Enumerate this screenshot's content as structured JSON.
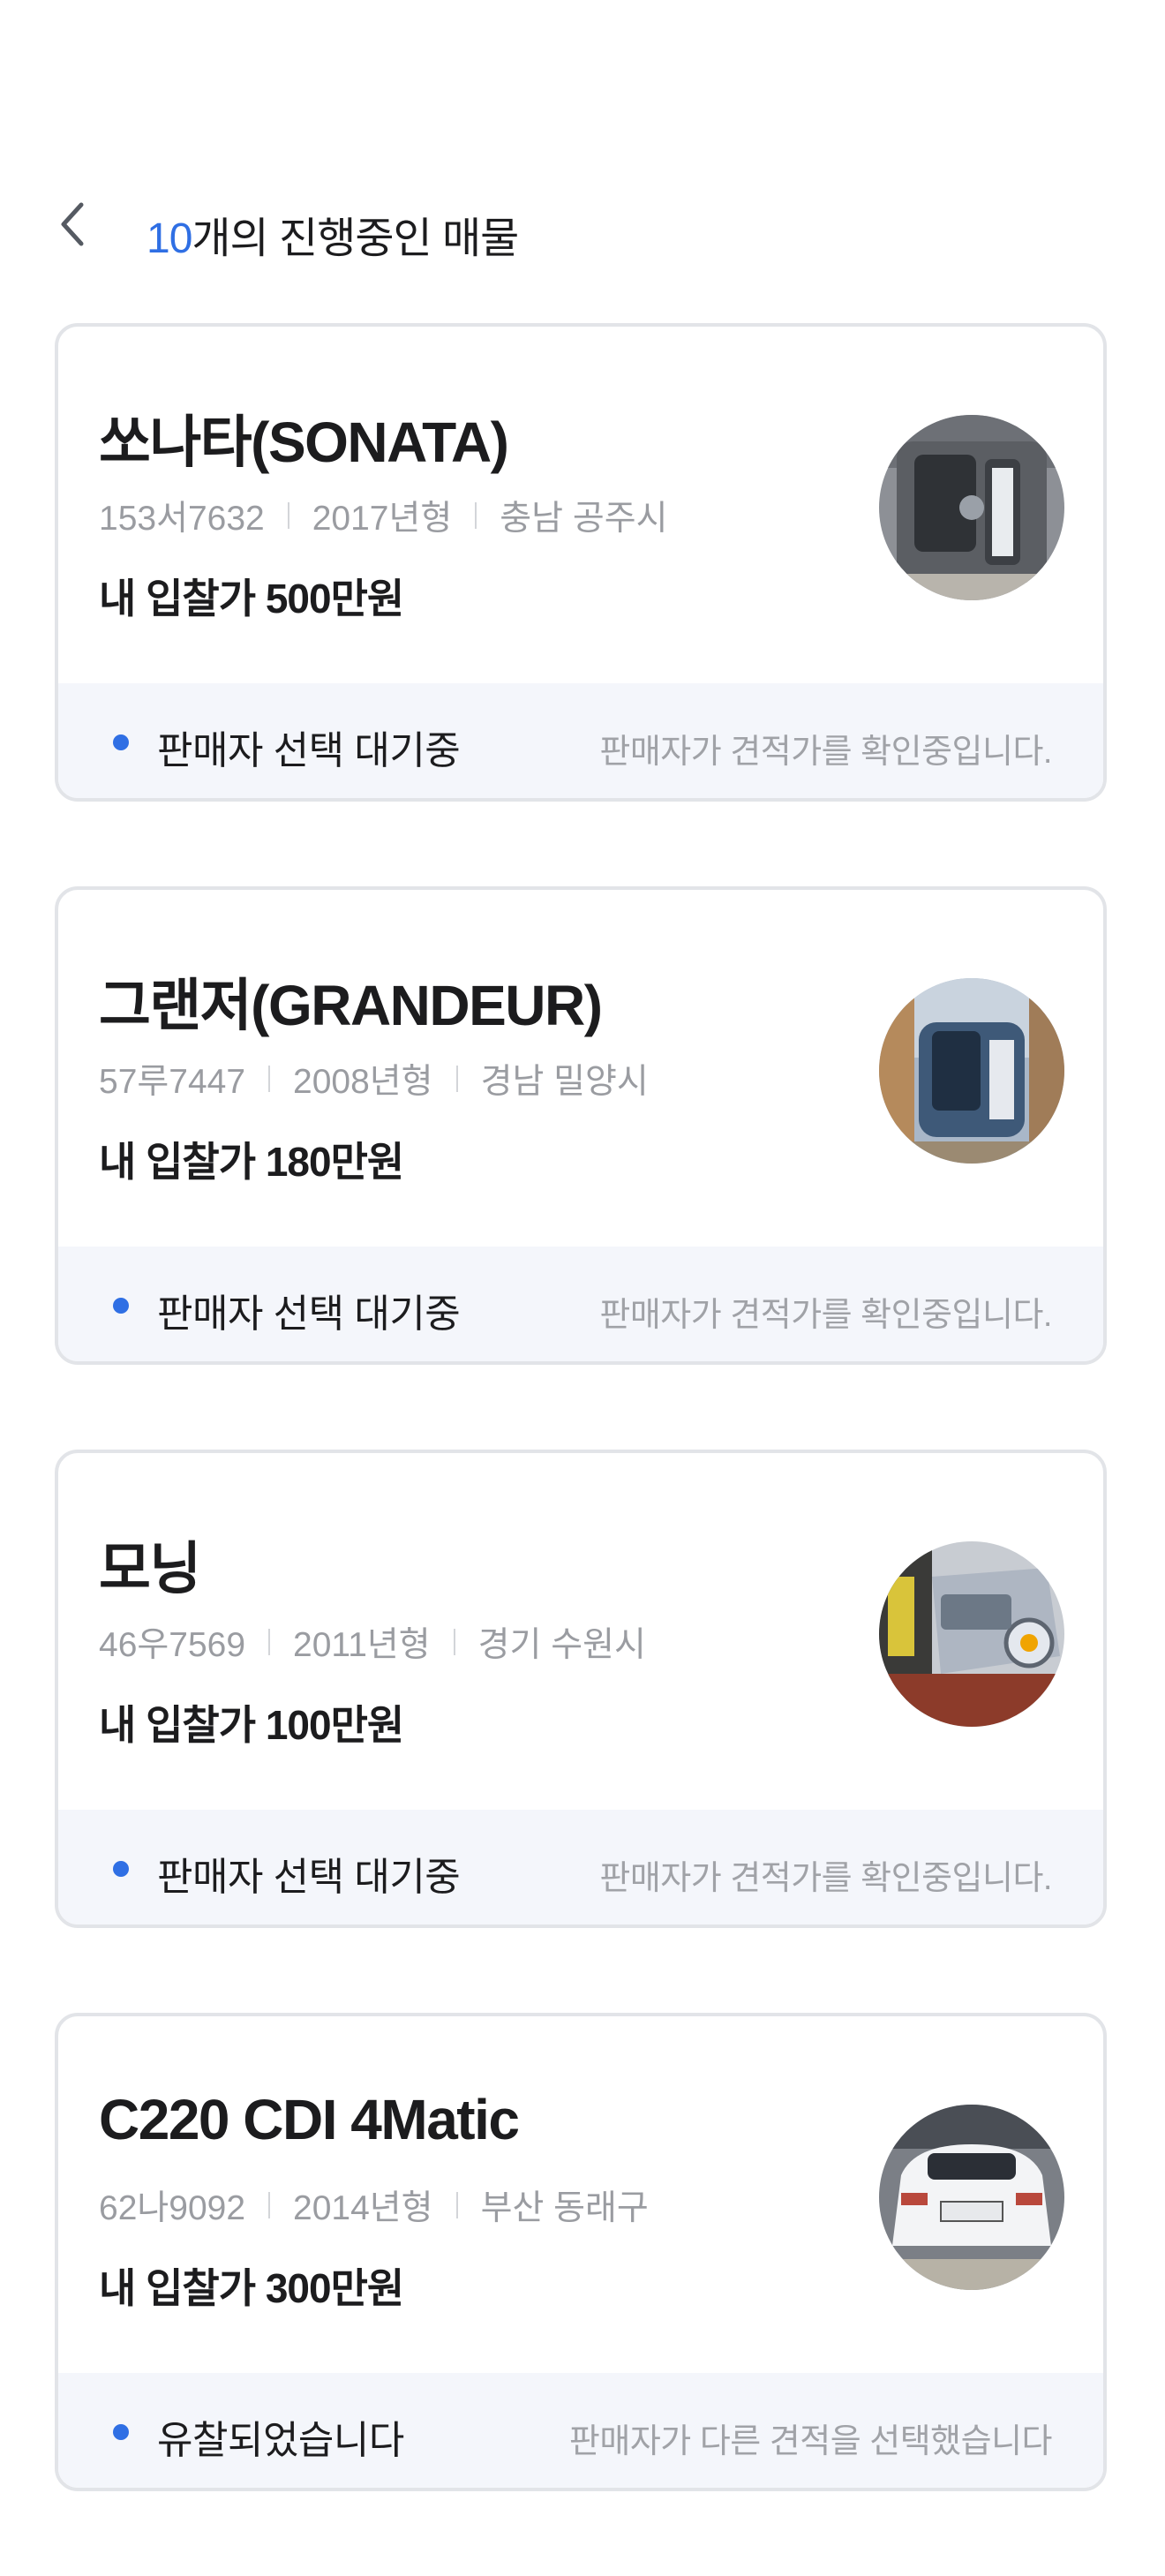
{
  "header": {
    "back_icon": "chevron-left-icon",
    "count": "10",
    "title_suffix": "개의 진행중인 매물"
  },
  "colors": {
    "accent": "#2f6fe4",
    "card_border": "#e2e4e8",
    "status_bg": "#f4f6fb",
    "muted_text": "#9a9ca1"
  },
  "listings": [
    {
      "name": "쏘나타(SONATA)",
      "plate": "153서7632",
      "year": "2017년형",
      "location": "충남 공주시",
      "bid": "내 입찰가 500만원",
      "status": "판매자 선택 대기중",
      "status_desc": "판매자가 견적가를 확인중입니다.",
      "photo": "gray-sedan-front"
    },
    {
      "name": "그랜저(GRANDEUR)",
      "plate": "57루7447",
      "year": "2008년형",
      "location": "경남 밀양시",
      "bid": "내 입찰가 180만원",
      "status": "판매자 선택 대기중",
      "status_desc": "판매자가 견적가를 확인중입니다.",
      "photo": "blue-sedan-front"
    },
    {
      "name": "모닝",
      "plate": "46우7569",
      "year": "2011년형",
      "location": "경기 수원시",
      "bid": "내 입찰가 100만원",
      "status": "판매자 선택 대기중",
      "status_desc": "판매자가 견적가를 확인중입니다.",
      "photo": "silver-hatchback-side"
    },
    {
      "name": "C220 CDI 4Matic",
      "plate": "62나9092",
      "year": "2014년형",
      "location": "부산 동래구",
      "bid": "내 입찰가 300만원",
      "status": "유찰되었습니다",
      "status_desc": "판매자가 다른 견적을 선택했습니다",
      "photo": "white-sedan-rear"
    }
  ]
}
